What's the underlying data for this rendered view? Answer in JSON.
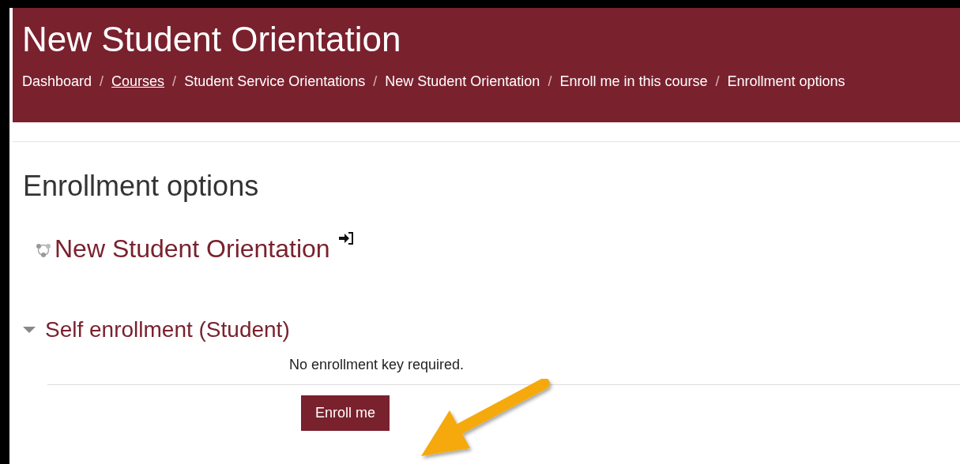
{
  "header": {
    "title": "New Student Orientation",
    "breadcrumbs": [
      {
        "label": "Dashboard",
        "underlined": false
      },
      {
        "label": "Courses",
        "underlined": true
      },
      {
        "label": "Student Service Orientations",
        "underlined": false
      },
      {
        "label": "New Student Orientation",
        "underlined": false
      },
      {
        "label": "Enroll me in this course",
        "underlined": false
      },
      {
        "label": "Enrollment options",
        "underlined": false
      }
    ],
    "separator": "/"
  },
  "page_heading": "Enrollment options",
  "course": {
    "name": "New Student Orientation"
  },
  "section": {
    "title": "Self enrollment (Student)",
    "expanded": true,
    "message": "No enrollment key required.",
    "button": "Enroll me"
  }
}
